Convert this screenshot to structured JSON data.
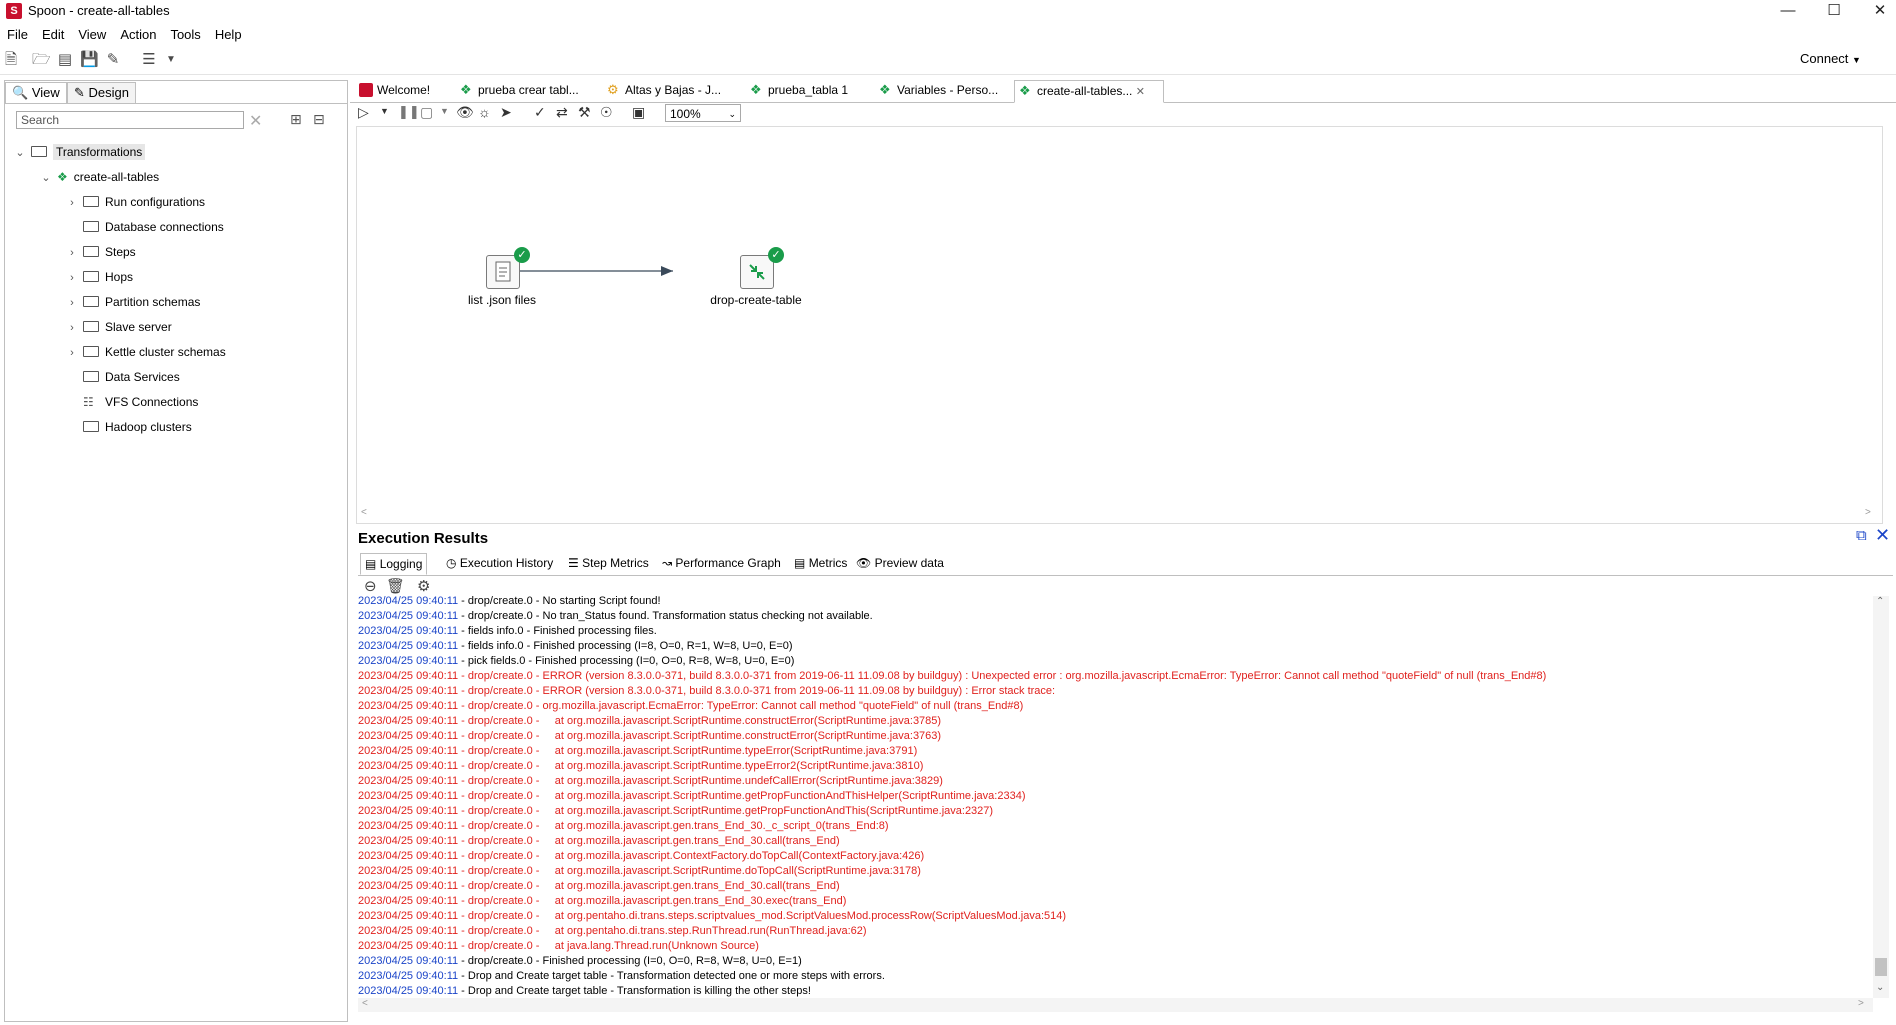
{
  "window": {
    "title": "Spoon - create-all-tables",
    "app_icon": "S"
  },
  "menu": [
    "File",
    "Edit",
    "View",
    "Action",
    "Tools",
    "Help"
  ],
  "toolbar": {
    "connect_label": "Connect"
  },
  "left_panel": {
    "tabs": [
      "View",
      "Design"
    ],
    "search_placeholder": "Search",
    "tree": {
      "root": "Transformations",
      "transformation": "create-all-tables",
      "items": [
        "Run configurations",
        "Database connections",
        "Steps",
        "Hops",
        "Partition schemas",
        "Slave server",
        "Kettle cluster schemas",
        "Data Services",
        "VFS Connections",
        "Hadoop clusters"
      ]
    }
  },
  "editor_tabs": [
    {
      "label": "Welcome!"
    },
    {
      "label": "prueba crear tabl..."
    },
    {
      "label": "Altas y Bajas - J..."
    },
    {
      "label": "prueba_tabla 1"
    },
    {
      "label": "Variables - Perso..."
    },
    {
      "label": "create-all-tables..."
    }
  ],
  "zoom": "100%",
  "steps": [
    {
      "label": "list .json files"
    },
    {
      "label": "drop-create-table"
    }
  ],
  "execution": {
    "title": "Execution Results",
    "tabs": [
      "Logging",
      "Execution History",
      "Step Metrics",
      "Performance Graph",
      "Metrics",
      "Preview data"
    ],
    "log": [
      {
        "ts": "2023/04/25 09:40:11",
        "msg": " - drop/create.0 - No starting Script found!",
        "err": false
      },
      {
        "ts": "2023/04/25 09:40:11",
        "msg": " - drop/create.0 - No tran_Status found. Transformation status checking not available.",
        "err": false
      },
      {
        "ts": "2023/04/25 09:40:11",
        "msg": " - fields info.0 - Finished processing files.",
        "err": false
      },
      {
        "ts": "2023/04/25 09:40:11",
        "msg": " - fields info.0 - Finished processing (I=8, O=0, R=1, W=8, U=0, E=0)",
        "err": false
      },
      {
        "ts": "2023/04/25 09:40:11",
        "msg": " - pick fields.0 - Finished processing (I=0, O=0, R=8, W=8, U=0, E=0)",
        "err": false
      },
      {
        "ts": "2023/04/25 09:40:11",
        "msg": " - drop/create.0 - ERROR (version 8.3.0.0-371, build 8.3.0.0-371 from 2019-06-11 11.09.08 by buildguy) : Unexpected error : org.mozilla.javascript.EcmaError: TypeError: Cannot call method \"quoteField\" of null (trans_End#8)",
        "err": true
      },
      {
        "ts": "2023/04/25 09:40:11",
        "msg": " - drop/create.0 - ERROR (version 8.3.0.0-371, build 8.3.0.0-371 from 2019-06-11 11.09.08 by buildguy) : Error stack trace:",
        "err": true
      },
      {
        "ts": "2023/04/25 09:40:11",
        "msg": " - drop/create.0 - org.mozilla.javascript.EcmaError: TypeError: Cannot call method \"quoteField\" of null (trans_End#8)",
        "err": true
      },
      {
        "ts": "2023/04/25 09:40:11",
        "msg": " - drop/create.0 -     at org.mozilla.javascript.ScriptRuntime.constructError(ScriptRuntime.java:3785)",
        "err": true
      },
      {
        "ts": "2023/04/25 09:40:11",
        "msg": " - drop/create.0 -     at org.mozilla.javascript.ScriptRuntime.constructError(ScriptRuntime.java:3763)",
        "err": true
      },
      {
        "ts": "2023/04/25 09:40:11",
        "msg": " - drop/create.0 -     at org.mozilla.javascript.ScriptRuntime.typeError(ScriptRuntime.java:3791)",
        "err": true
      },
      {
        "ts": "2023/04/25 09:40:11",
        "msg": " - drop/create.0 -     at org.mozilla.javascript.ScriptRuntime.typeError2(ScriptRuntime.java:3810)",
        "err": true
      },
      {
        "ts": "2023/04/25 09:40:11",
        "msg": " - drop/create.0 -     at org.mozilla.javascript.ScriptRuntime.undefCallError(ScriptRuntime.java:3829)",
        "err": true
      },
      {
        "ts": "2023/04/25 09:40:11",
        "msg": " - drop/create.0 -     at org.mozilla.javascript.ScriptRuntime.getPropFunctionAndThisHelper(ScriptRuntime.java:2334)",
        "err": true
      },
      {
        "ts": "2023/04/25 09:40:11",
        "msg": " - drop/create.0 -     at org.mozilla.javascript.ScriptRuntime.getPropFunctionAndThis(ScriptRuntime.java:2327)",
        "err": true
      },
      {
        "ts": "2023/04/25 09:40:11",
        "msg": " - drop/create.0 -     at org.mozilla.javascript.gen.trans_End_30._c_script_0(trans_End:8)",
        "err": true
      },
      {
        "ts": "2023/04/25 09:40:11",
        "msg": " - drop/create.0 -     at org.mozilla.javascript.gen.trans_End_30.call(trans_End)",
        "err": true
      },
      {
        "ts": "2023/04/25 09:40:11",
        "msg": " - drop/create.0 -     at org.mozilla.javascript.ContextFactory.doTopCall(ContextFactory.java:426)",
        "err": true
      },
      {
        "ts": "2023/04/25 09:40:11",
        "msg": " - drop/create.0 -     at org.mozilla.javascript.ScriptRuntime.doTopCall(ScriptRuntime.java:3178)",
        "err": true
      },
      {
        "ts": "2023/04/25 09:40:11",
        "msg": " - drop/create.0 -     at org.mozilla.javascript.gen.trans_End_30.call(trans_End)",
        "err": true
      },
      {
        "ts": "2023/04/25 09:40:11",
        "msg": " - drop/create.0 -     at org.mozilla.javascript.gen.trans_End_30.exec(trans_End)",
        "err": true
      },
      {
        "ts": "2023/04/25 09:40:11",
        "msg": " - drop/create.0 -     at org.pentaho.di.trans.steps.scriptvalues_mod.ScriptValuesMod.processRow(ScriptValuesMod.java:514)",
        "err": true
      },
      {
        "ts": "2023/04/25 09:40:11",
        "msg": " - drop/create.0 -     at org.pentaho.di.trans.step.RunThread.run(RunThread.java:62)",
        "err": true
      },
      {
        "ts": "2023/04/25 09:40:11",
        "msg": " - drop/create.0 -     at java.lang.Thread.run(Unknown Source)",
        "err": true
      },
      {
        "ts": "2023/04/25 09:40:11",
        "msg": " - drop/create.0 - Finished processing (I=0, O=0, R=8, W=8, U=0, E=1)",
        "err": false
      },
      {
        "ts": "2023/04/25 09:40:11",
        "msg": " - Drop and Create target table - Transformation detected one or more steps with errors.",
        "err": false
      },
      {
        "ts": "2023/04/25 09:40:11",
        "msg": " - Drop and Create target table - Transformation is killing the other steps!",
        "err": false
      }
    ]
  },
  "colors": {
    "error": "#e0221e",
    "timestamp": "#1a44c8",
    "success": "#1a9c4a",
    "brand": "#c8102e"
  }
}
